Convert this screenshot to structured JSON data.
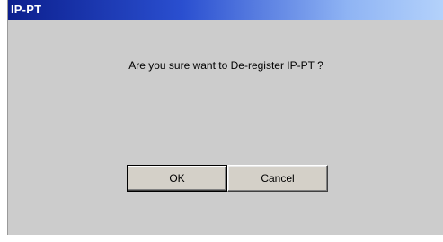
{
  "window": {
    "title": "IP-PT"
  },
  "dialog": {
    "message": "Are you sure want to De-register IP-PT ?",
    "ok_label": "OK",
    "cancel_label": "Cancel"
  },
  "colors": {
    "titlebar_start": "#0c1f8e",
    "titlebar_end": "#b4d2fb",
    "dialog_background": "#cccccc",
    "title_text": "#ffffff"
  }
}
